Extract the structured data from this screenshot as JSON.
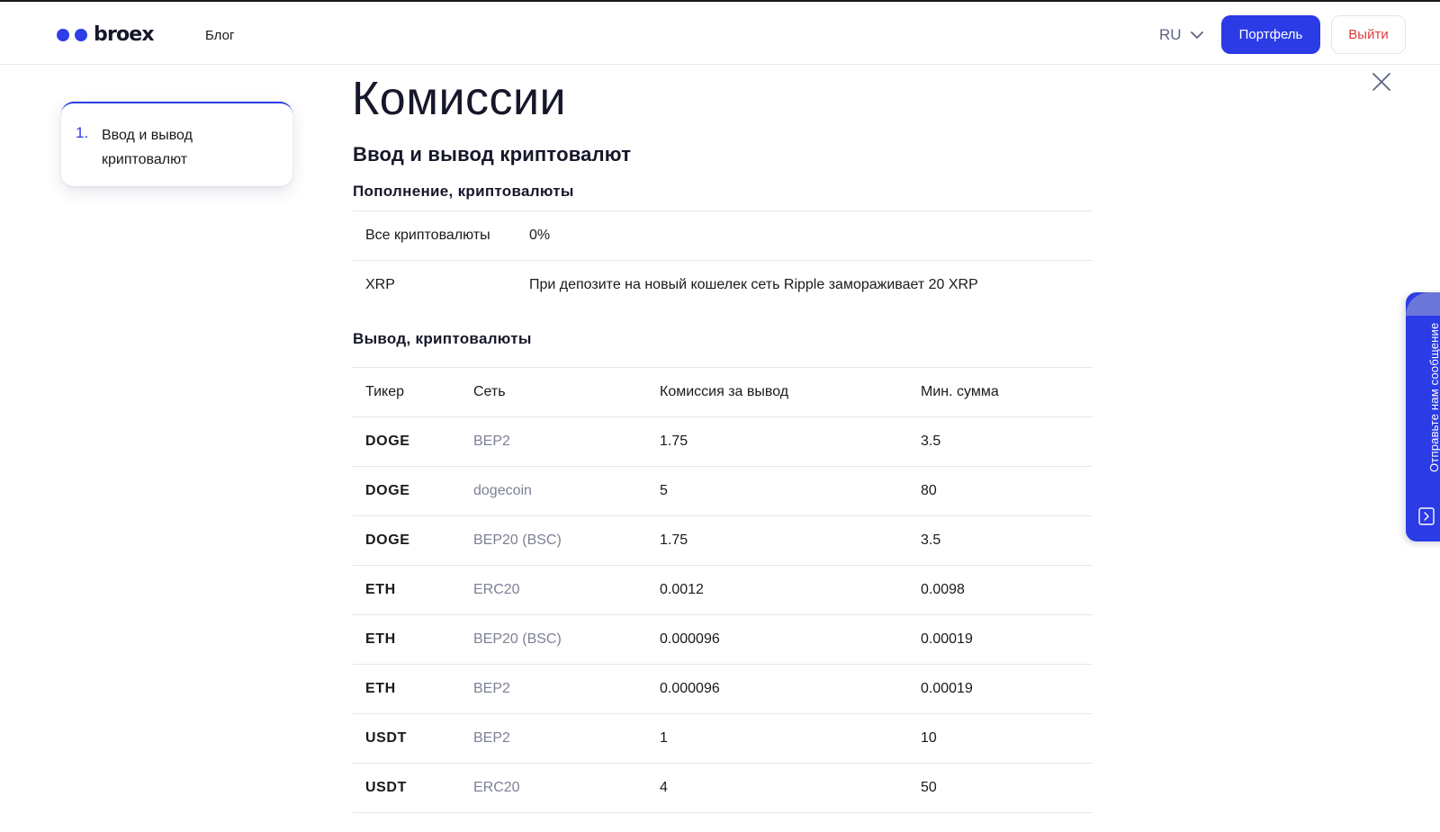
{
  "header": {
    "logo_text": "broex",
    "nav_blog": "Блог",
    "lang": "RU",
    "portfolio_button": "Портфель",
    "logout_button": "Выйти"
  },
  "toc": {
    "items": [
      {
        "number": "1.",
        "label": "Ввод и вывод криптовалют"
      }
    ]
  },
  "main": {
    "title": "Комиссии",
    "section_title": "Ввод и вывод криптовалют",
    "deposit": {
      "title": "Пополнение, криптовалюты",
      "rows": [
        {
          "name": "Все криптовалюты",
          "value": "0%"
        },
        {
          "name": "XRP",
          "value": "При депозите на новый кошелек сеть Ripple замораживает 20 XRP"
        }
      ]
    },
    "withdraw": {
      "title": "Вывод, криптовалюты",
      "headers": [
        "Тикер",
        "Сеть",
        "Комиссия за вывод",
        "Мин. сумма"
      ],
      "rows": [
        {
          "ticker": "DOGE",
          "network": "BEP2",
          "fee": "1.75",
          "min": "3.5"
        },
        {
          "ticker": "DOGE",
          "network": "dogecoin",
          "fee": "5",
          "min": "80"
        },
        {
          "ticker": "DOGE",
          "network": "BEP20 (BSC)",
          "fee": "1.75",
          "min": "3.5"
        },
        {
          "ticker": "ETH",
          "network": "ERC20",
          "fee": "0.0012",
          "min": "0.0098"
        },
        {
          "ticker": "ETH",
          "network": "BEP20 (BSC)",
          "fee": "0.000096",
          "min": "0.00019"
        },
        {
          "ticker": "ETH",
          "network": "BEP2",
          "fee": "0.000096",
          "min": "0.00019"
        },
        {
          "ticker": "USDT",
          "network": "BEP2",
          "fee": "1",
          "min": "10"
        },
        {
          "ticker": "USDT",
          "network": "ERC20",
          "fee": "4",
          "min": "50"
        }
      ]
    }
  },
  "feedback": {
    "label": "Отправьте нам сообщение"
  },
  "icons": {
    "logo": "logo-dots",
    "lang_toggle": "chevron-down-icon",
    "close": "close-icon",
    "feedback": "message-arrow-icon"
  },
  "colors": {
    "accent": "#2b3be6",
    "logout_text": "#e23b3b",
    "muted_text": "#7d8196",
    "lang_text": "#5d6480"
  }
}
